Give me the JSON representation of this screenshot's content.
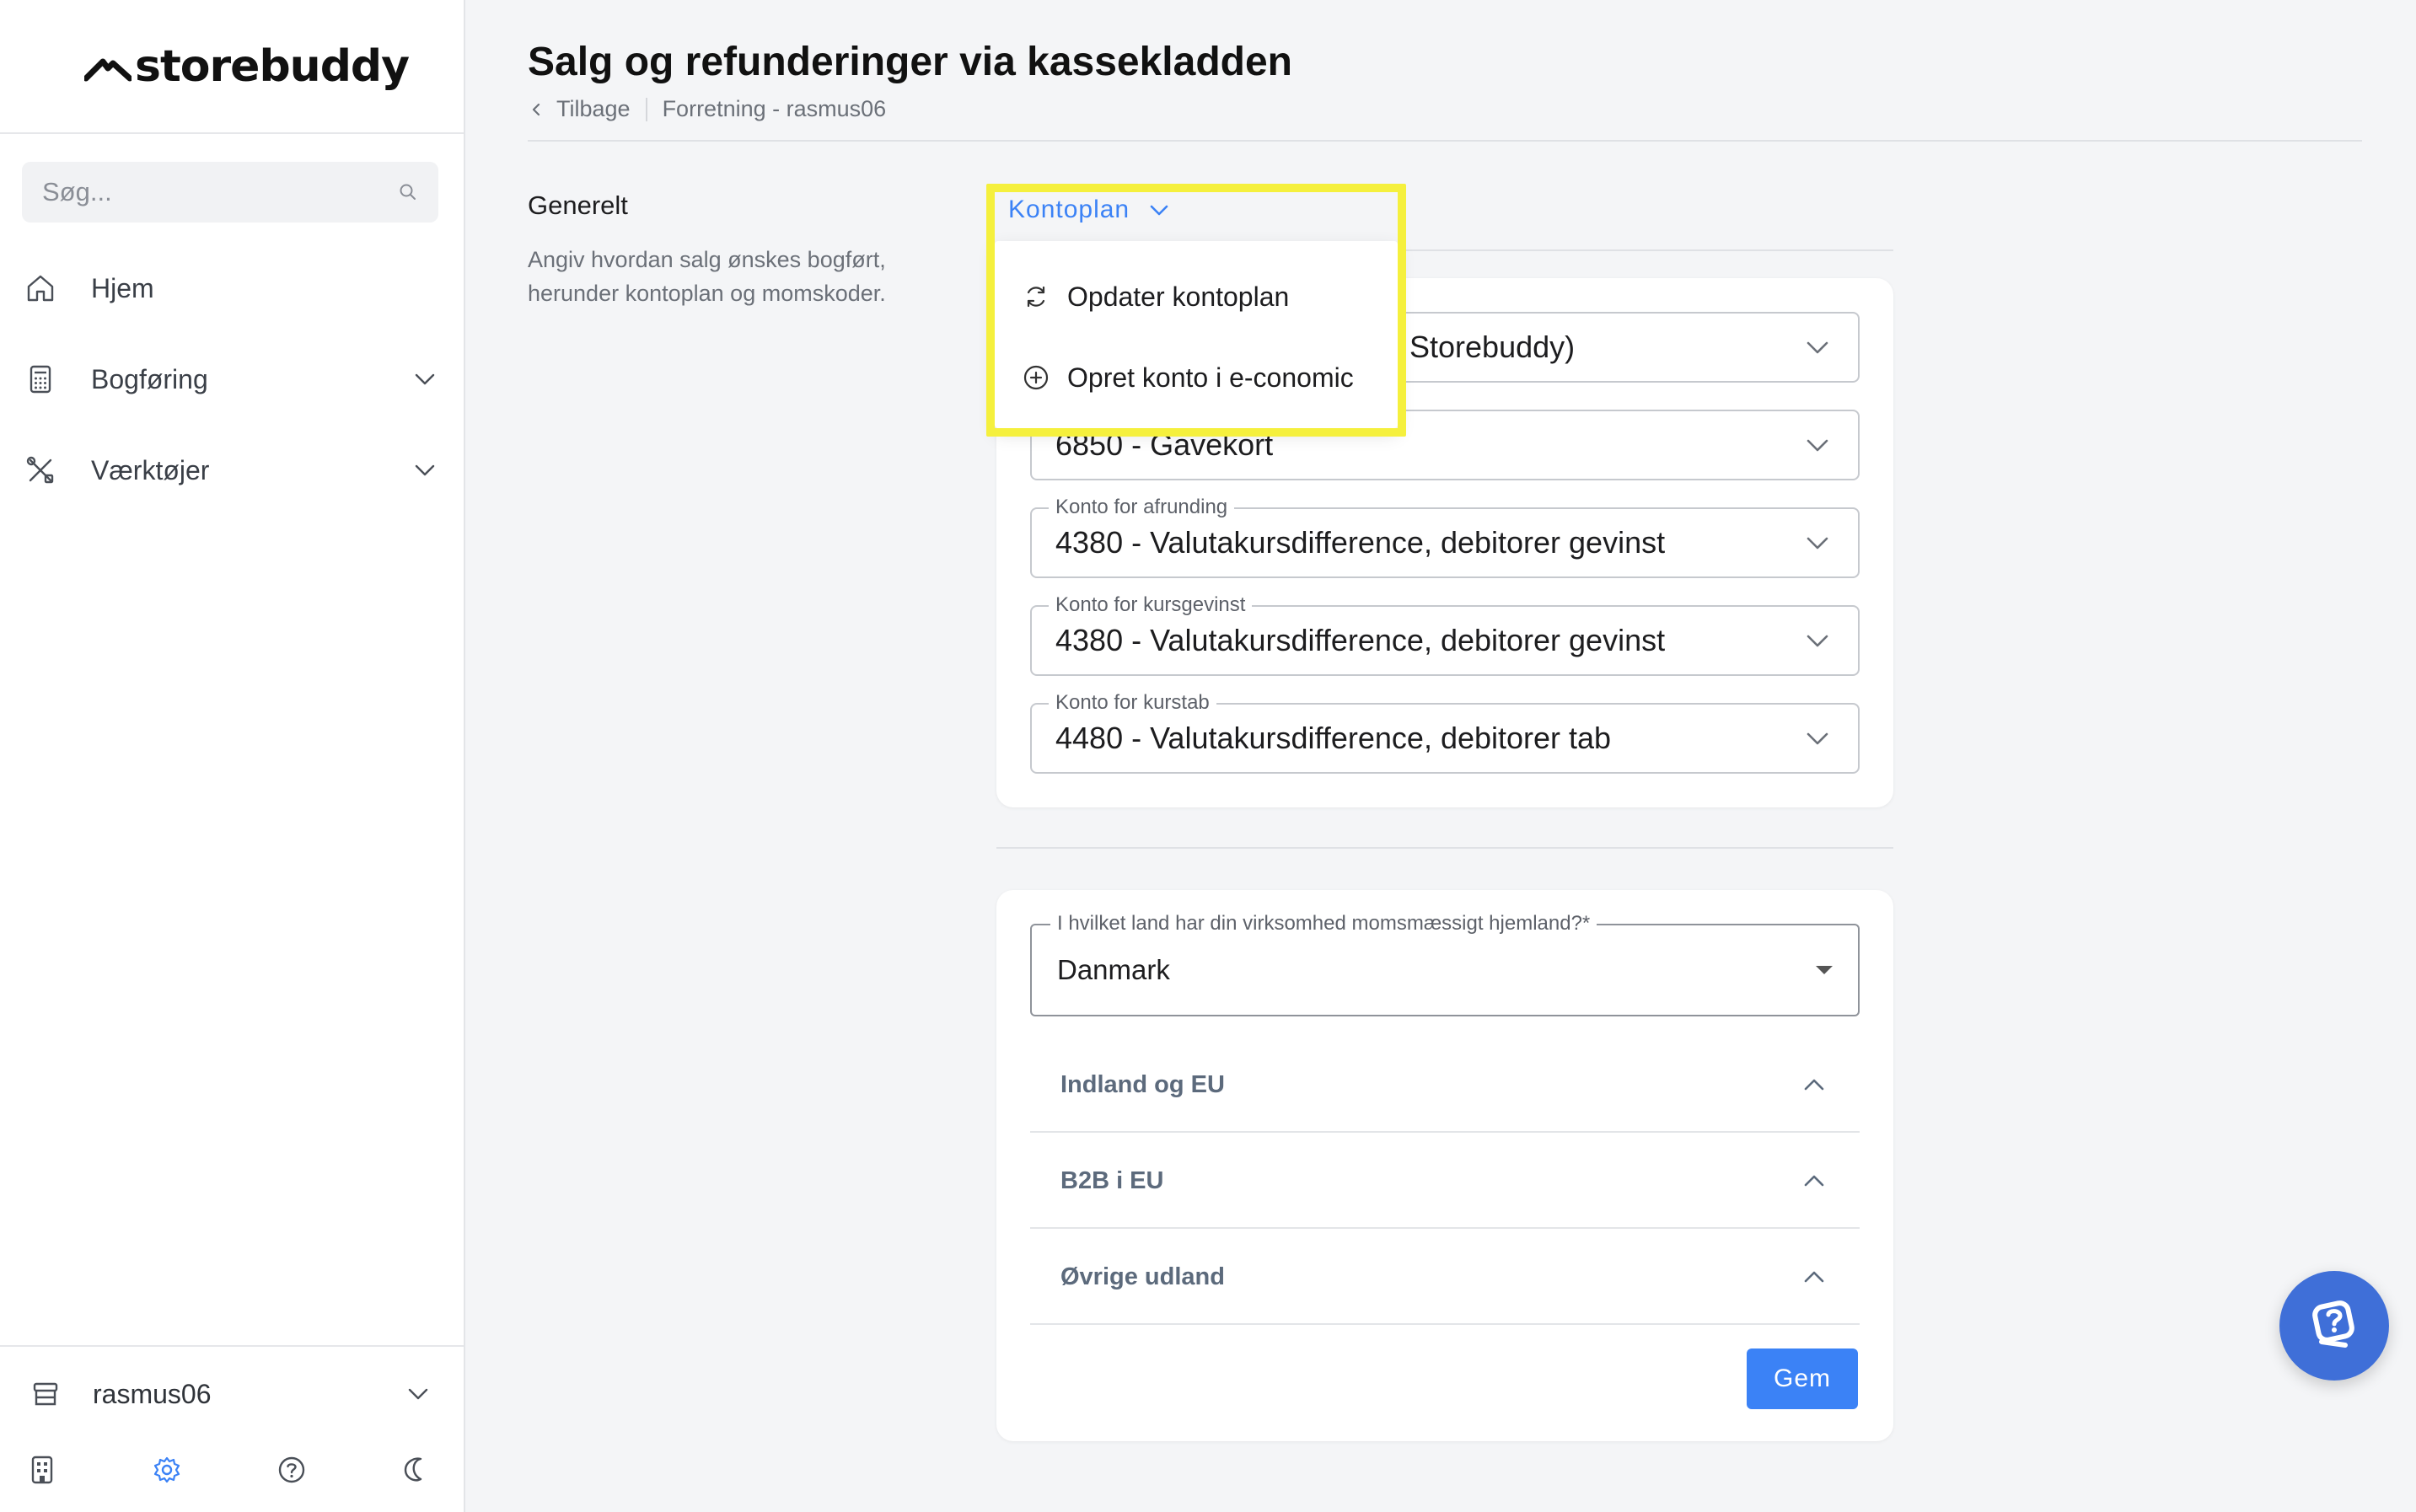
{
  "brand": {
    "name": "storebuddy"
  },
  "search": {
    "placeholder": "Søg..."
  },
  "sidebar": {
    "items": [
      {
        "label": "Hjem",
        "icon": "home-icon"
      },
      {
        "label": "Bogføring",
        "icon": "calculator-icon"
      },
      {
        "label": "Værktøjer",
        "icon": "tools-icon"
      }
    ],
    "shop": {
      "label": "rasmus06",
      "icon": "store-icon"
    },
    "footer_icons": [
      "building-icon",
      "gear-icon",
      "help-circle-icon",
      "moon-icon"
    ]
  },
  "header": {
    "title": "Salg og refunderinger via kassekladden",
    "back_label": "Tilbage",
    "breadcrumb": "Forretning - rasmus06"
  },
  "general": {
    "title": "Generelt",
    "description": "Angiv hvordan salg ønskes bogført, herunder kontoplan og momskoder."
  },
  "kontoplan": {
    "trigger_label": "Kontoplan",
    "menu": [
      {
        "label": "Opdater kontoplan",
        "icon": "refresh-icon"
      },
      {
        "label": "Opret konto i e-conomic",
        "icon": "plus-circle-icon"
      }
    ]
  },
  "accounts": [
    {
      "label": "",
      "value": "Storebuddy)"
    },
    {
      "label": "",
      "value": "6850 - Gavekort"
    },
    {
      "label": "Konto for afrunding",
      "value": "4380 - Valutakursdifference, debitorer gevinst"
    },
    {
      "label": "Konto for kursgevinst",
      "value": "4380 - Valutakursdifference, debitorer gevinst"
    },
    {
      "label": "Konto for kurstab",
      "value": "4480 - Valutakursdifference, debitorer tab"
    }
  ],
  "vat": {
    "country_label": "I hvilket land har din virksomhed momsmæssigt hjemland?*",
    "country_value": "Danmark",
    "sections": [
      "Indland og EU",
      "B2B i EU",
      "Øvrige udland"
    ],
    "save_label": "Gem"
  },
  "colors": {
    "accent": "#3b82f6",
    "highlight": "#f5f03d",
    "fab": "#3f6fd8"
  }
}
